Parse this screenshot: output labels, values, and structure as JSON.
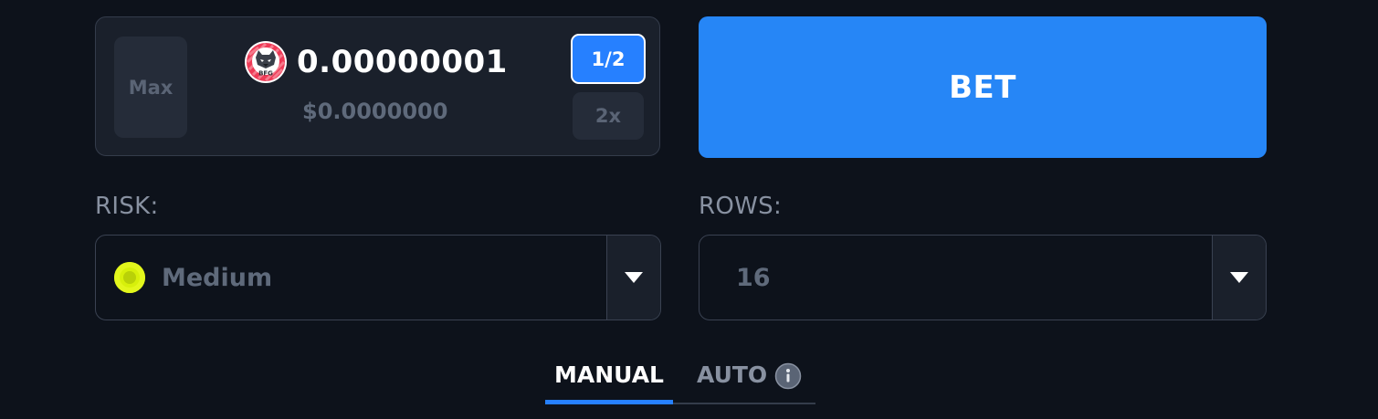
{
  "bet_amount": {
    "max_label": "Max",
    "amount": "0.00000001",
    "usd": "$0.0000000",
    "half_label": "1/2",
    "double_label": "2x",
    "coin_icon": "bfg-coin-icon",
    "coin_text": "BFG"
  },
  "bet_button": {
    "label": "BET"
  },
  "risk": {
    "label": "RISK:",
    "value": "Medium",
    "color": "#d7f00b"
  },
  "rows": {
    "label": "ROWS:",
    "value": "16"
  },
  "tabs": [
    {
      "label": "MANUAL",
      "active": true
    },
    {
      "label": "AUTO",
      "active": false
    }
  ],
  "colors": {
    "accent": "#2680ff",
    "bet_button": "#2686f6",
    "background": "#0d121b",
    "panel": "#1a202b"
  }
}
